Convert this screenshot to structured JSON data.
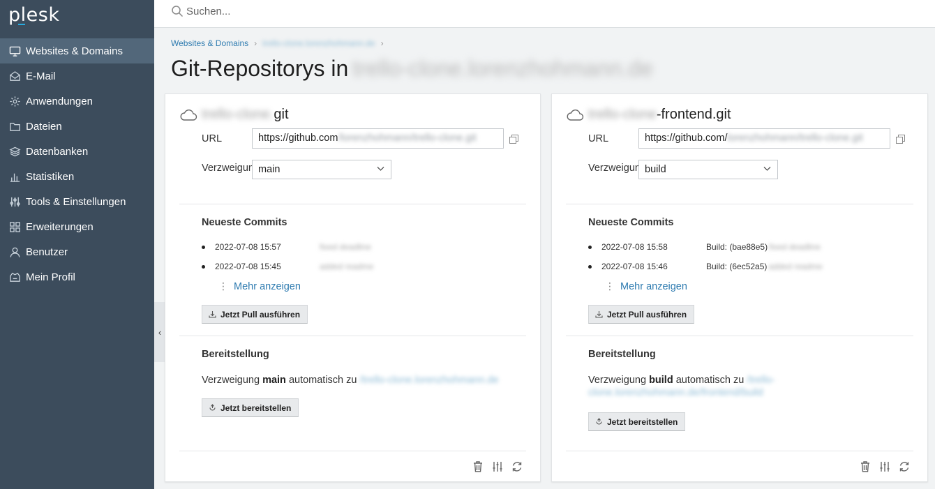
{
  "app": {
    "logo": "plesk"
  },
  "sidebar": {
    "items": [
      {
        "label": "Websites & Domains",
        "icon": "monitor-icon",
        "active": true
      },
      {
        "label": "E-Mail",
        "icon": "mail-icon"
      },
      {
        "label": "Anwendungen",
        "icon": "gear-icon"
      },
      {
        "label": "Dateien",
        "icon": "folder-icon"
      },
      {
        "label": "Datenbanken",
        "icon": "database-icon"
      },
      {
        "label": "Statistiken",
        "icon": "bar-chart-icon"
      },
      {
        "label": "Tools & Einstellungen",
        "icon": "sliders-icon"
      },
      {
        "label": "Erweiterungen",
        "icon": "extensions-icon"
      },
      {
        "label": "Benutzer",
        "icon": "user-icon"
      },
      {
        "label": "Mein Profil",
        "icon": "profile-icon"
      }
    ]
  },
  "search": {
    "placeholder": "Suchen..."
  },
  "breadcrumb": {
    "root": "Websites & Domains",
    "domain": "trello-clone.lorenzhohmann.de"
  },
  "page": {
    "title": "Git-Repositorys in",
    "domain": "trello-clone.lorenzhohmann.de"
  },
  "labels": {
    "url": "URL",
    "branch": "Verzweigung",
    "latest_commits": "Neueste Commits",
    "show_more": "Mehr anzeigen",
    "pull": "Jetzt Pull ausführen",
    "deployment": "Bereitstellung",
    "deploy_prefix": "Verzweigung",
    "deploy_mid": "automatisch zu",
    "deploy_now": "Jetzt bereitstellen"
  },
  "repos": [
    {
      "name_blur": "trello-clone.",
      "name": "git",
      "url": "https://github.com",
      "url_blur": "/lorenzhohmann/trello-clone.git",
      "branch": "main",
      "commits": [
        {
          "date": "2022-07-08 15:57",
          "msg": "",
          "msg_blur": "fixed deadline"
        },
        {
          "date": "2022-07-08 15:45",
          "msg": "",
          "msg_blur": "added readme"
        }
      ],
      "deploy_branch": "main",
      "deploy_target": "/trello-clone.lorenzhohmann.de"
    },
    {
      "name_blur": "trello-clone",
      "name": "-frontend.git",
      "url": "https://github.com/",
      "url_blur": "lorenzhohmann/trello-clone.git",
      "branch": "build",
      "commits": [
        {
          "date": "2022-07-08 15:58",
          "msg": "Build: (bae88e5)",
          "msg_blur": " fixed deadline"
        },
        {
          "date": "2022-07-08 15:46",
          "msg": "Build: (6ec52a5)",
          "msg_blur": " added readme"
        }
      ],
      "deploy_branch": "build",
      "deploy_target_1": "/trello-",
      "deploy_target_2": "clone.lorenzhohmann.de/frontend/build"
    }
  ]
}
